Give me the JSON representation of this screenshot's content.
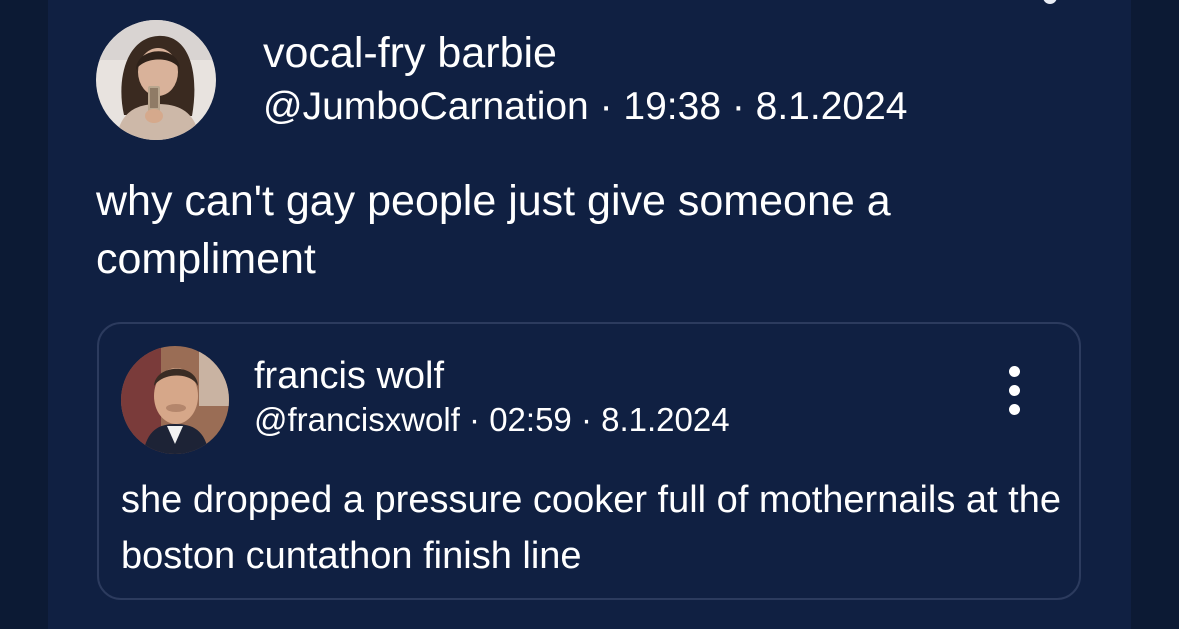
{
  "post": {
    "display_name": "vocal-fry barbie",
    "meta": "@JumboCarnation · 19:38 · 8.1.2024",
    "text": "why can't gay people just give someone a compliment",
    "avatar_icon": "profile-photo"
  },
  "quoted_post": {
    "display_name": "francis wolf",
    "meta": "@francisxwolf · 02:59 · 8.1.2024",
    "text": "she dropped a pressure cooker full of mothernails at the boston cuntathon finish line",
    "avatar_icon": "profile-photo",
    "more_icon": "more-vertical-icon"
  },
  "colors": {
    "background": "#0c1a34",
    "card": "#102042",
    "border": "#2c3b5e",
    "text": "#ffffff"
  }
}
